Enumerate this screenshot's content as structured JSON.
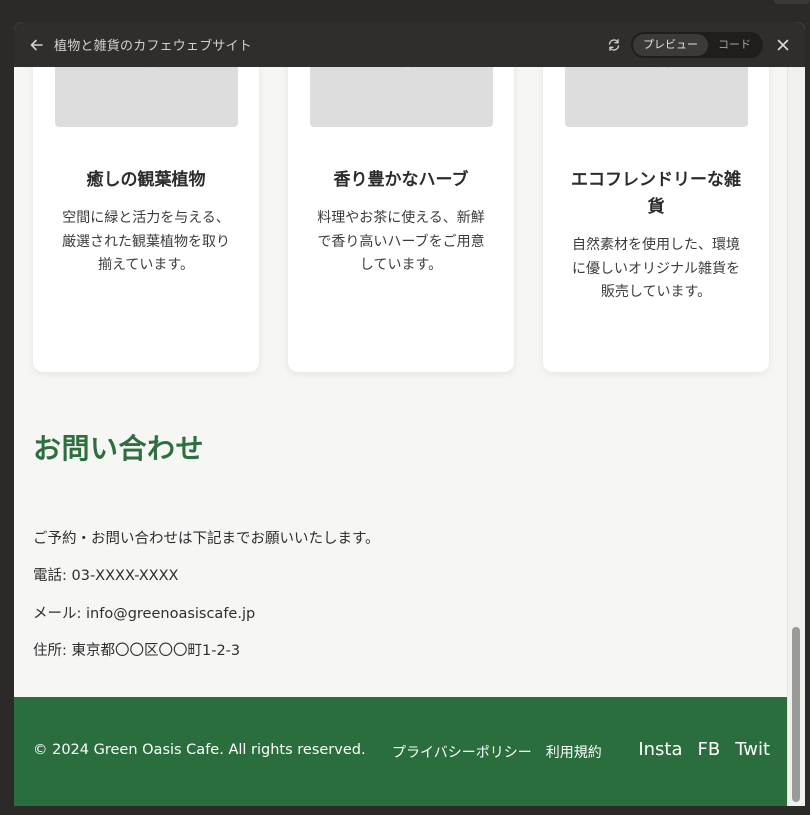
{
  "window": {
    "title": "植物と雑貨のカフェウェブサイト",
    "toggle": {
      "preview": "プレビュー",
      "code": "コード"
    }
  },
  "icons": {
    "back": "arrow-left-icon",
    "refresh": "refresh-icon",
    "close": "close-icon"
  },
  "cards": [
    {
      "placeholder_x": "×",
      "placeholder_size": "200",
      "title_lines": [
        "癒しの観葉植物"
      ],
      "desc_lines": [
        "空間に緑と活力を与える、",
        "厳選された観葉植物を取り",
        "揃えています。"
      ]
    },
    {
      "placeholder_x": "×",
      "placeholder_size": "200",
      "title_lines": [
        "香り豊かなハーブ"
      ],
      "desc_lines": [
        "料理やお茶に使える、新鮮",
        "で香り高いハーブをご用意",
        "しています。"
      ]
    },
    {
      "placeholder_x": "×",
      "placeholder_size": "200",
      "title_lines": [
        "エコフレンドリーな雑",
        "貨"
      ],
      "desc_lines": [
        "自然素材を使用した、環境",
        "に優しいオリジナル雑貨を",
        "販売しています。"
      ]
    }
  ],
  "contact": {
    "heading": "お問い合わせ",
    "intro": "ご予約・お問い合わせは下記までお願いいたします。",
    "phone": "電話: 03-XXXX-XXXX",
    "email": "メール: info@greenoasiscafe.jp",
    "address": "住所: 東京都〇〇区〇〇町1-2-3"
  },
  "footer": {
    "copyright": "© 2024 Green Oasis Cafe. All rights reserved.",
    "links": [
      "プライバシーポリシー",
      "利用規約"
    ],
    "social": [
      "Insta",
      "FB",
      "Twit"
    ]
  },
  "colors": {
    "brand_green": "#2b6e3d",
    "heading_green": "#2e6e3f",
    "titlebar": "#2f2e2c"
  }
}
